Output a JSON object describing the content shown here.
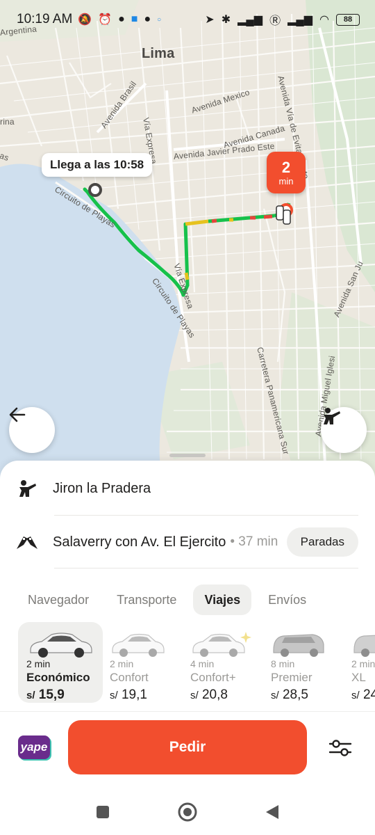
{
  "status_bar": {
    "time": "10:19 AM",
    "battery": "88"
  },
  "map": {
    "city_label": "Lima",
    "street_labels": [
      "Argentina",
      "Avenida Brasil",
      "Vía Expresa",
      "Avenida Mexico",
      "Avenida Canada",
      "Avenida Javier Prado Este",
      "Circuito de Playas",
      "Vía Expresa",
      "Circuito de Playas",
      "Carretera Panamericana Sur",
      "Avenida Vía de Evitamiento",
      "Avenida San Ju",
      "Avenida Miguel Iglesi",
      "rina",
      "as"
    ],
    "eta_bubble": "Llega a las 10:58",
    "time_badge": {
      "value": "2",
      "unit": "min"
    },
    "route_color": "#16c14b",
    "traffic_colors": [
      "#e6c21e",
      "#e6463c"
    ]
  },
  "route": {
    "origin": "Jiron la Pradera",
    "destination": "Salaverry con Av. El Ejercito",
    "duration": "• 37 min",
    "stops_button": "Paradas"
  },
  "tabs": [
    {
      "label": "Navegador",
      "active": false
    },
    {
      "label": "Transporte",
      "active": false
    },
    {
      "label": "Viajes",
      "active": true
    },
    {
      "label": "Envíos",
      "active": false
    }
  ],
  "tariffs": [
    {
      "eta": "2 min",
      "name": "Económico",
      "currency": "s/",
      "price": "15,9",
      "active": true
    },
    {
      "eta": "2 min",
      "name": "Confort",
      "currency": "s/",
      "price": "19,1",
      "active": false
    },
    {
      "eta": "4 min",
      "name": "Confort+",
      "currency": "s/",
      "price": "20,8",
      "active": false
    },
    {
      "eta": "8 min",
      "name": "Premier",
      "currency": "s/",
      "price": "28,5",
      "active": false
    },
    {
      "eta": "2 min",
      "name": "XL",
      "currency": "s/",
      "price": "24",
      "active": false
    }
  ],
  "actions": {
    "payment_label": "yape",
    "order_button": "Pedir"
  },
  "colors": {
    "accent": "#f24e2e",
    "payment_brand": "#6a2c8c",
    "water": "#cfdfee",
    "park": "#d6e6cf"
  }
}
